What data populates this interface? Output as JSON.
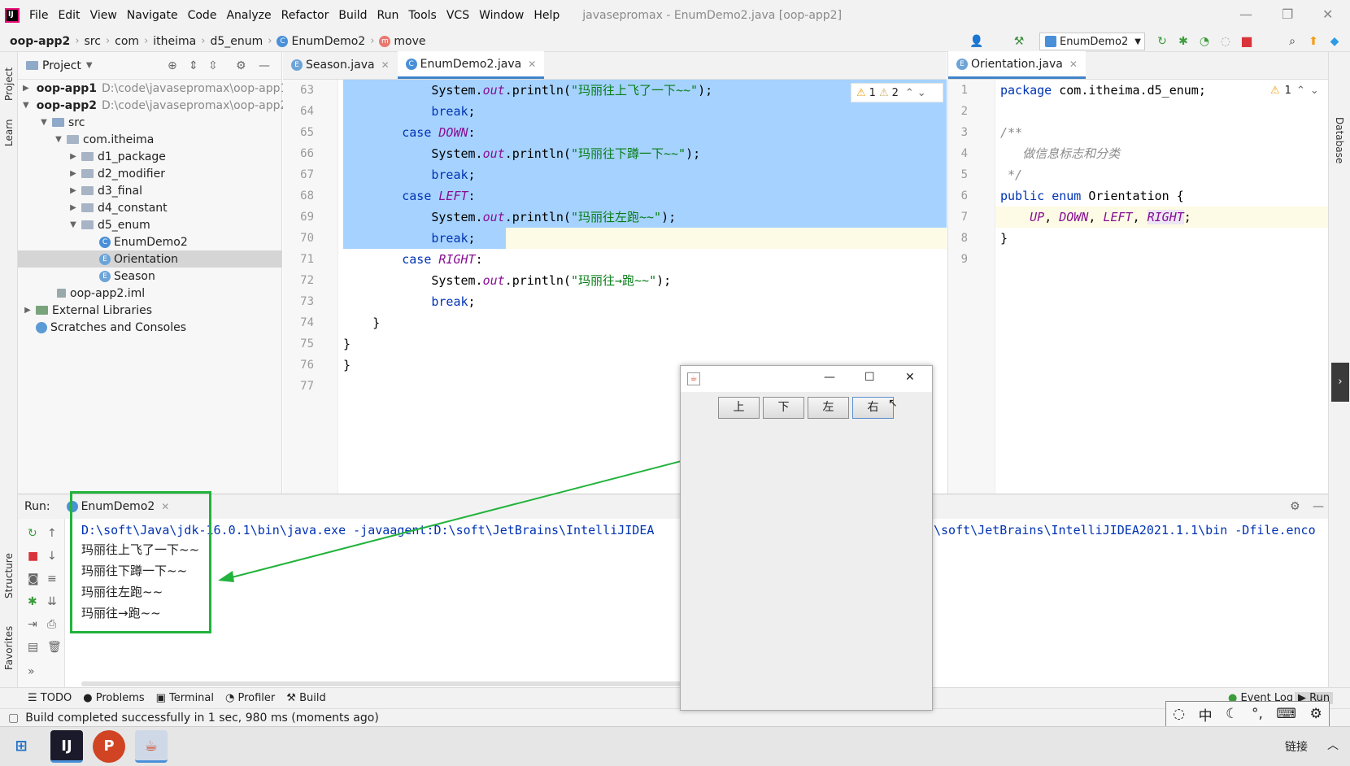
{
  "menu": {
    "items": [
      "File",
      "Edit",
      "View",
      "Navigate",
      "Code",
      "Analyze",
      "Refactor",
      "Build",
      "Run",
      "Tools",
      "VCS",
      "Window",
      "Help"
    ],
    "window_title": "javasepromax - EnumDemo2.java [oop-app2]"
  },
  "breadcrumb": {
    "items": [
      "oop-app2",
      "src",
      "com",
      "itheima",
      "d5_enum",
      "EnumDemo2",
      "move"
    ]
  },
  "toolbar": {
    "run_config": "EnumDemo2"
  },
  "side_strip": {
    "project": "Project",
    "learn": "Learn",
    "structure": "Structure",
    "favorites": "Favorites",
    "database": "Database"
  },
  "project_panel": {
    "title": "Project",
    "tree": [
      {
        "label": "oop-app1",
        "path": "D:\\code\\javasepromax\\oop-app1",
        "bold": true
      },
      {
        "label": "oop-app2",
        "path": "D:\\code\\javasepromax\\oop-app2",
        "bold": true
      },
      {
        "label": "src"
      },
      {
        "label": "com.itheima"
      },
      {
        "label": "d1_package"
      },
      {
        "label": "d2_modifier"
      },
      {
        "label": "d3_final"
      },
      {
        "label": "d4_constant"
      },
      {
        "label": "d5_enum"
      },
      {
        "label": "EnumDemo2"
      },
      {
        "label": "Orientation"
      },
      {
        "label": "Season"
      },
      {
        "label": "oop-app2.iml"
      },
      {
        "label": "External Libraries"
      },
      {
        "label": "Scratches and Consoles"
      }
    ]
  },
  "editor_left": {
    "tabs": [
      "Season.java",
      "EnumDemo2.java"
    ],
    "inspections": {
      "warnings": "1",
      "weak_warnings": "2"
    },
    "lines": [
      {
        "n": "63",
        "code": "            System.out.println(\"玛丽往上飞了一下~~\");"
      },
      {
        "n": "64",
        "code": "            break;"
      },
      {
        "n": "65",
        "code": "        case DOWN:"
      },
      {
        "n": "66",
        "code": "            System.out.println(\"玛丽往下蹲一下~~\");"
      },
      {
        "n": "67",
        "code": "            break;"
      },
      {
        "n": "68",
        "code": "        case LEFT:"
      },
      {
        "n": "69",
        "code": "            System.out.println(\"玛丽往左跑~~\");"
      },
      {
        "n": "70",
        "code": "            break;"
      },
      {
        "n": "71",
        "code": "        case RIGHT:"
      },
      {
        "n": "72",
        "code": "            System.out.println(\"玛丽往→跑~~\");"
      },
      {
        "n": "73",
        "code": "            break;"
      },
      {
        "n": "74",
        "code": "    }"
      },
      {
        "n": "75",
        "code": "}"
      },
      {
        "n": "76",
        "code": "}"
      },
      {
        "n": "77",
        "code": ""
      }
    ]
  },
  "editor_right": {
    "tab": "Orientation.java",
    "inspections": {
      "warnings": "1"
    },
    "lines": [
      {
        "n": "1",
        "code": "package com.itheima.d5_enum;"
      },
      {
        "n": "2",
        "code": ""
      },
      {
        "n": "3",
        "code": "/**"
      },
      {
        "n": "4",
        "code": "   做信息标志和分类"
      },
      {
        "n": "5",
        "code": " */"
      },
      {
        "n": "6",
        "code": "public enum Orientation {"
      },
      {
        "n": "7",
        "code": "    UP, DOWN, LEFT, RIGHT;"
      },
      {
        "n": "8",
        "code": "}"
      },
      {
        "n": "9",
        "code": ""
      }
    ]
  },
  "run_panel": {
    "label": "Run:",
    "tab": "EnumDemo2",
    "command_left": "D:\\soft\\Java\\jdk-16.0.1\\bin\\java.exe -javaagent:D:\\soft\\JetBrains\\IntelliJIDEA",
    "command_right": "\\soft\\JetBrains\\IntelliJIDEA2021.1.1\\bin -Dfile.enco",
    "output": [
      "玛丽往上飞了一下~~",
      "玛丽往下蹲一下~~",
      "玛丽往左跑~~",
      "玛丽往→跑~~"
    ]
  },
  "bottom_tools": [
    "TODO",
    "Problems",
    "Terminal",
    "Profiler",
    "Build"
  ],
  "bottom_right": [
    "Event Log",
    "Run"
  ],
  "status": "Build completed successfully in 1 sec, 980 ms (moments ago)",
  "java_window": {
    "buttons": [
      "上",
      "下",
      "左",
      "右"
    ]
  },
  "ime": {
    "mode": "中"
  },
  "taskbar": {
    "tray_text": "链接"
  },
  "colors": {
    "highlight": "#22b33c",
    "selection": "#a6d2ff",
    "keyword": "#0033b3",
    "string": "#067d17",
    "enum_constant": "#871094"
  }
}
